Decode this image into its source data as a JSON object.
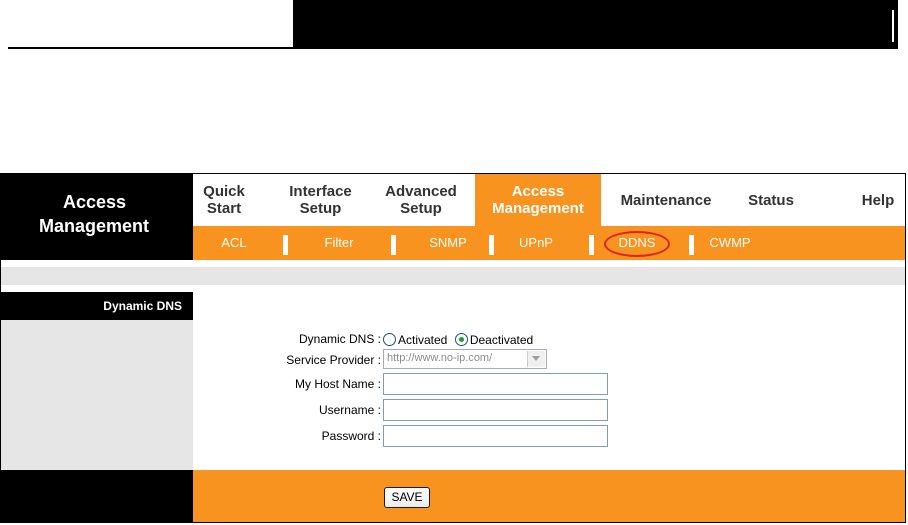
{
  "brand": {
    "line1": "Access",
    "line2": "Management"
  },
  "main_nav": [
    {
      "l1": "Quick",
      "l2": "Start",
      "active": false
    },
    {
      "l1": "Interface",
      "l2": "Setup",
      "active": false
    },
    {
      "l1": "Advanced",
      "l2": "Setup",
      "active": false
    },
    {
      "l1": "Access",
      "l2": "Management",
      "active": true
    },
    {
      "l1": "Maintenance",
      "l2": "",
      "active": false
    },
    {
      "l1": "Status",
      "l2": "",
      "active": false
    },
    {
      "l1": "Help",
      "l2": "",
      "active": false
    }
  ],
  "sub_nav": [
    "ACL",
    "Filter",
    "SNMP",
    "UPnP",
    "DDNS",
    "CWMP"
  ],
  "section": {
    "label": "Dynamic DNS"
  },
  "form": {
    "dynamic_dns": {
      "label": "Dynamic DNS :",
      "options": [
        "Activated",
        "Deactivated"
      ],
      "selected": "Deactivated"
    },
    "service_provider": {
      "label": "Service Provider :",
      "value": "http://www.no-ip.com/"
    },
    "host_name": {
      "label": "My Host Name :",
      "value": ""
    },
    "username": {
      "label": "Username :",
      "value": ""
    },
    "password": {
      "label": "Password :",
      "value": ""
    }
  },
  "save_label": "SAVE",
  "colors": {
    "accent": "#f7931e",
    "nav_text": "#333333",
    "highlight_circle": "#d9252a"
  }
}
